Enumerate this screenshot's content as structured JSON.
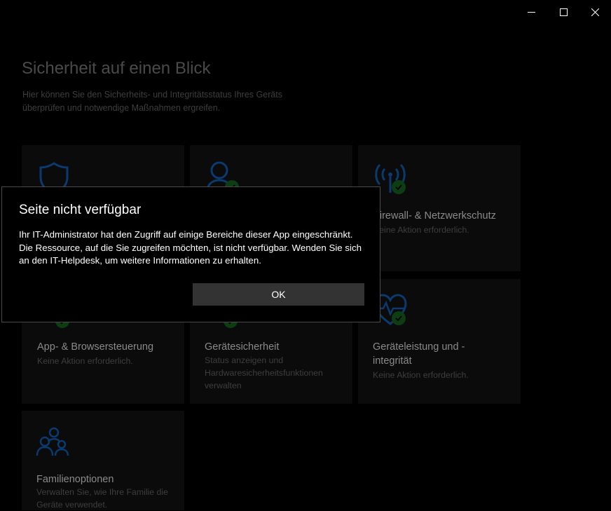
{
  "window": {
    "minimize_icon": "minimize-icon",
    "maximize_icon": "maximize-icon",
    "close_icon": "close-icon"
  },
  "page": {
    "title": "Sicherheit auf einen Blick",
    "subtitle": "Hier können Sie den Sicherheits- und Integritätsstatus Ihres Geräts überprüfen und notwendige Maßnahmen ergreifen."
  },
  "tiles": [
    {
      "id": "virus",
      "icon": "shield-icon",
      "title": "",
      "desc": ""
    },
    {
      "id": "account",
      "icon": "person-icon",
      "title": "",
      "desc": ""
    },
    {
      "id": "firewall",
      "icon": "antenna-icon",
      "title": "Firewall- & Netzwerkschutz",
      "desc": "Keine Aktion erforderlich."
    },
    {
      "id": "app",
      "icon": "app-browser-icon",
      "title": "App- & Browsersteuerung",
      "desc": "Keine Aktion erforderlich."
    },
    {
      "id": "device",
      "icon": "device-icon",
      "title": "Gerätesicherheit",
      "desc": "Status anzeigen und Hardwaresicherheitsfunktionen verwalten"
    },
    {
      "id": "performance",
      "icon": "heart-icon",
      "title": "Geräteleistung und -integrität",
      "desc": "Keine Aktion erforderlich."
    },
    {
      "id": "family",
      "icon": "family-icon",
      "title": "Familienoptionen",
      "desc": "Verwalten Sie, wie Ihre Familie die Geräte verwendet."
    }
  ],
  "dialog": {
    "title": "Seite nicht verfügbar",
    "body": "Ihr IT-Administrator hat den Zugriff auf einige Bereiche dieser App eingeschränkt. Die Ressource, auf die Sie zugreifen möchten, ist nicht verfügbar. Wenden Sie sich an den IT-Helpdesk, um weitere Informationen zu erhalten.",
    "ok_label": "OK"
  },
  "colors": {
    "accent": "#0a3a6e",
    "ok_check": "#0d3d12",
    "dialog_button": "#333333"
  }
}
